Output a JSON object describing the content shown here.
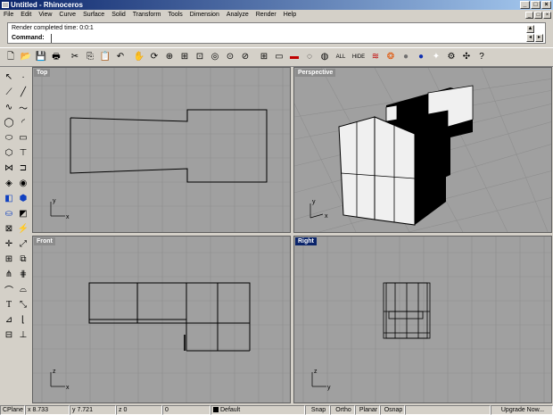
{
  "window": {
    "title": "Untitled - Rhinoceros",
    "minimize": "_",
    "maximize": "□",
    "close": "×"
  },
  "menu": [
    "File",
    "Edit",
    "View",
    "Curve",
    "Surface",
    "Solid",
    "Transform",
    "Tools",
    "Dimension",
    "Analyze",
    "Render",
    "Help"
  ],
  "command": {
    "history": "Render completed time: 0:0:1",
    "prompt": "Command:",
    "value": ""
  },
  "toolbar": {
    "all_label": "ALL",
    "hide_label": "HIDE"
  },
  "viewports": {
    "top": "Top",
    "perspective": "Perspective",
    "front": "Front",
    "right": "Right"
  },
  "axes": {
    "top": [
      "x",
      "y"
    ],
    "perspective": [
      "x",
      "y"
    ],
    "front": [
      "x",
      "z"
    ],
    "right": [
      "y",
      "z"
    ]
  },
  "status": {
    "cplane": "CPlane",
    "x": "x 8.733",
    "y": "y 7.721",
    "z": "z 0",
    "extra": "0",
    "layer": "Default",
    "snap": "Snap",
    "ortho": "Ortho",
    "planar": "Planar",
    "osnap": "Osnap",
    "upgrade": "Upgrade Now..."
  },
  "colors": {
    "viewport_bg": "#a0a0a0",
    "active_title": "#0a246a",
    "grid": "#8e8e8e"
  }
}
